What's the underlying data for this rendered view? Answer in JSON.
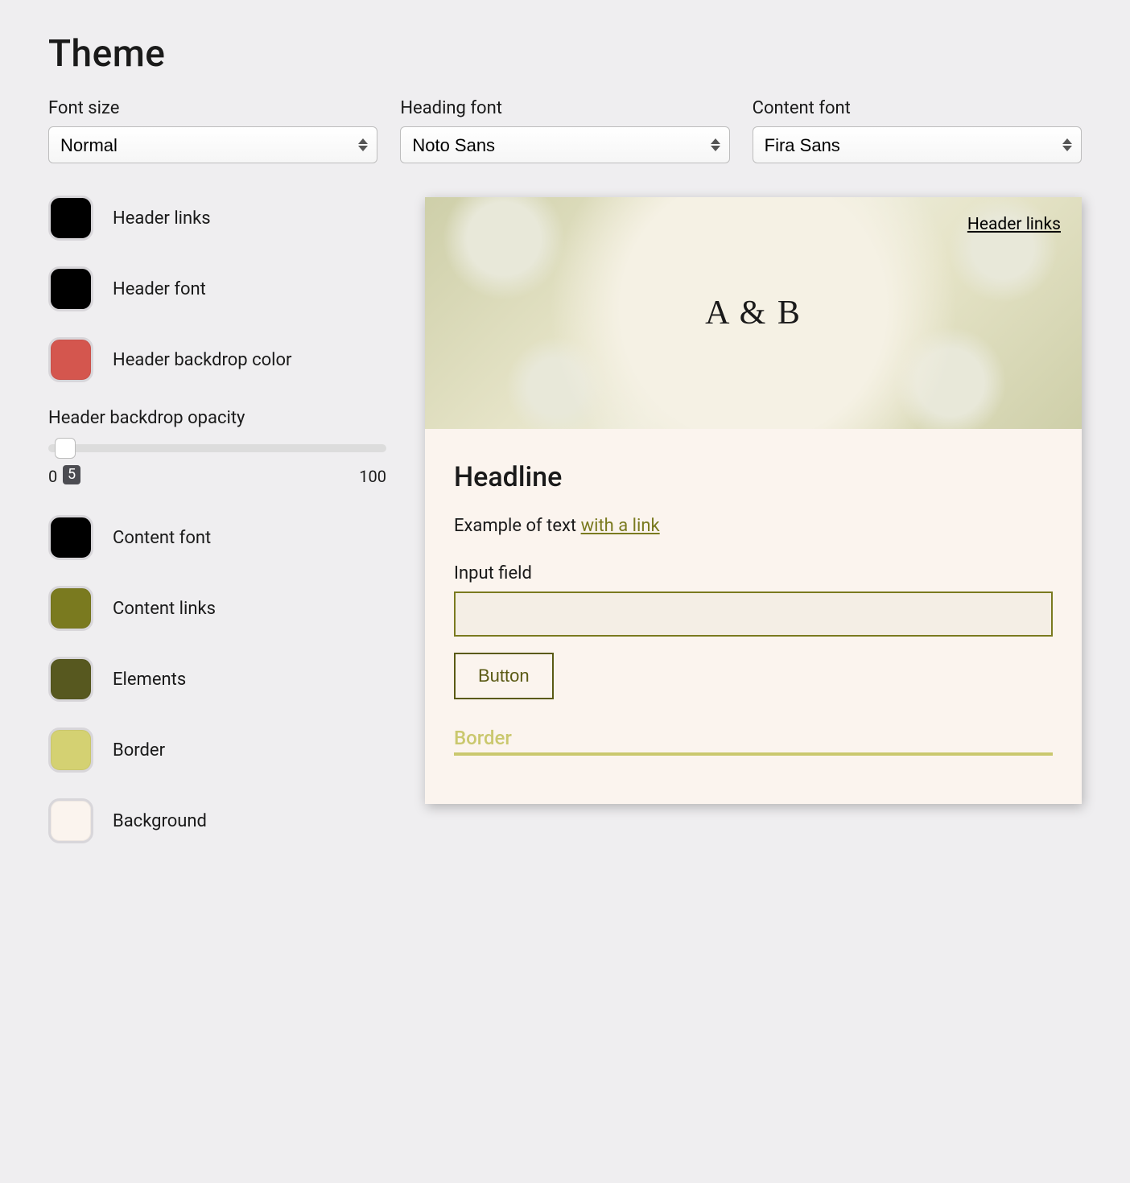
{
  "title": "Theme",
  "fonts": {
    "size_label": "Font size",
    "size_value": "Normal",
    "heading_label": "Heading font",
    "heading_value": "Noto Sans",
    "content_label": "Content font",
    "content_value": "Fira Sans"
  },
  "swatches": {
    "header_links": {
      "label": "Header links",
      "color": "#000000"
    },
    "header_font": {
      "label": "Header font",
      "color": "#000000"
    },
    "header_backdrop_color": {
      "label": "Header backdrop color",
      "color": "#d4564e"
    },
    "content_font": {
      "label": "Content font",
      "color": "#000000"
    },
    "content_links": {
      "label": "Content links",
      "color": "#7a7a1f"
    },
    "elements": {
      "label": "Elements",
      "color": "#57581f"
    },
    "border": {
      "label": "Border",
      "color": "#d4d172"
    },
    "background": {
      "label": "Background",
      "color": "#fbf4ee"
    }
  },
  "opacity": {
    "label": "Header backdrop opacity",
    "min": "0",
    "max": "100",
    "value": "5"
  },
  "preview": {
    "header_link": "Header links",
    "monogram": "A & B",
    "headline": "Headline",
    "sample_text": "Example of text ",
    "sample_link": "with a link",
    "input_label": "Input field",
    "button_label": "Button",
    "border_label": "Border"
  }
}
